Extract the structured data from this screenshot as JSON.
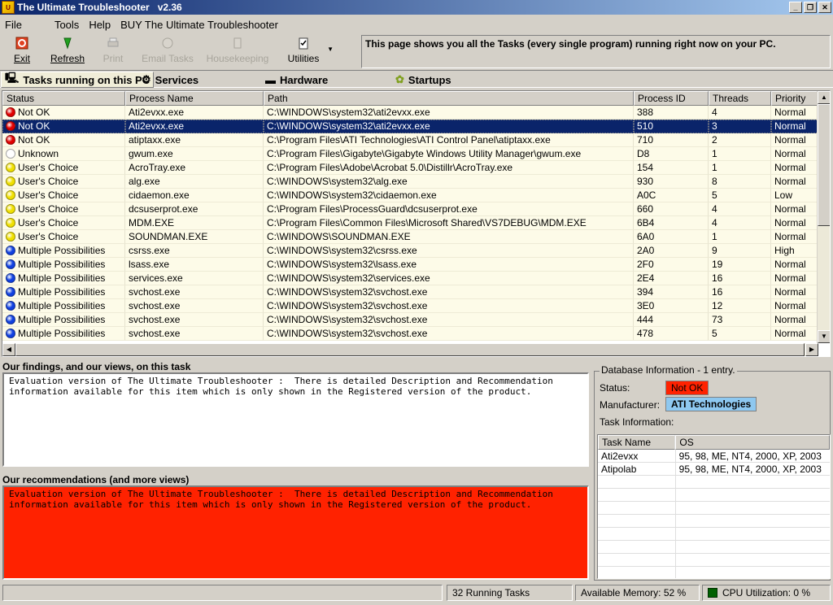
{
  "window": {
    "title": "The Ultimate Troubleshooter   v2.36"
  },
  "menu": [
    "File",
    "Tools",
    "Help",
    "BUY The Ultimate Troubleshooter"
  ],
  "toolbar": {
    "exit": "Exit",
    "refresh": "Refresh",
    "print": "Print",
    "email": "Email Tasks",
    "housekeeping": "Housekeeping",
    "utilities": "Utilities"
  },
  "info_text": "This page shows you all the Tasks (every single program) running right now on your PC.",
  "tabs": {
    "tasks": "Tasks running on this PC",
    "services": "Services",
    "hardware": "Hardware",
    "startups": "Startups"
  },
  "columns": [
    "Status",
    "Process Name",
    "Path",
    "Process ID",
    "Threads",
    "Priority"
  ],
  "status_colors": {
    "Not OK": "#e00000",
    "Unknown": "#ffffff",
    "User's Choice": "#f0e000",
    "Multiple Possibilities": "#1040e0"
  },
  "rows": [
    [
      "Not OK",
      "Ati2evxx.exe",
      "C:\\WINDOWS\\system32\\ati2evxx.exe",
      "388",
      "4",
      "Normal"
    ],
    [
      "Not OK",
      "Ati2evxx.exe",
      "C:\\WINDOWS\\system32\\ati2evxx.exe",
      "510",
      "3",
      "Normal"
    ],
    [
      "Not OK",
      "atiptaxx.exe",
      "C:\\Program Files\\ATI Technologies\\ATI Control Panel\\atiptaxx.exe",
      "710",
      "2",
      "Normal"
    ],
    [
      "Unknown",
      "gwum.exe",
      "C:\\Program Files\\Gigabyte\\Gigabyte Windows Utility Manager\\gwum.exe",
      "D8",
      "1",
      "Normal"
    ],
    [
      "User's Choice",
      "AcroTray.exe",
      "C:\\Program Files\\Adobe\\Acrobat 5.0\\Distillr\\AcroTray.exe",
      "154",
      "1",
      "Normal"
    ],
    [
      "User's Choice",
      "alg.exe",
      "C:\\WINDOWS\\system32\\alg.exe",
      "930",
      "8",
      "Normal"
    ],
    [
      "User's Choice",
      "cidaemon.exe",
      "C:\\WINDOWS\\system32\\cidaemon.exe",
      "A0C",
      "5",
      "Low"
    ],
    [
      "User's Choice",
      "dcsuserprot.exe",
      "C:\\Program Files\\ProcessGuard\\dcsuserprot.exe",
      "660",
      "4",
      "Normal"
    ],
    [
      "User's Choice",
      "MDM.EXE",
      "C:\\Program Files\\Common Files\\Microsoft Shared\\VS7DEBUG\\MDM.EXE",
      "6B4",
      "4",
      "Normal"
    ],
    [
      "User's Choice",
      "SOUNDMAN.EXE",
      "C:\\WINDOWS\\SOUNDMAN.EXE",
      "6A0",
      "1",
      "Normal"
    ],
    [
      "Multiple Possibilities",
      "csrss.exe",
      "C:\\WINDOWS\\system32\\csrss.exe",
      "2A0",
      "9",
      "High"
    ],
    [
      "Multiple Possibilities",
      "lsass.exe",
      "C:\\WINDOWS\\system32\\lsass.exe",
      "2F0",
      "19",
      "Normal"
    ],
    [
      "Multiple Possibilities",
      "services.exe",
      "C:\\WINDOWS\\system32\\services.exe",
      "2E4",
      "16",
      "Normal"
    ],
    [
      "Multiple Possibilities",
      "svchost.exe",
      "C:\\WINDOWS\\system32\\svchost.exe",
      "394",
      "16",
      "Normal"
    ],
    [
      "Multiple Possibilities",
      "svchost.exe",
      "C:\\WINDOWS\\system32\\svchost.exe",
      "3E0",
      "12",
      "Normal"
    ],
    [
      "Multiple Possibilities",
      "svchost.exe",
      "C:\\WINDOWS\\system32\\svchost.exe",
      "444",
      "73",
      "Normal"
    ],
    [
      "Multiple Possibilities",
      "svchost.exe",
      "C:\\WINDOWS\\system32\\svchost.exe",
      "478",
      "5",
      "Normal"
    ]
  ],
  "selected_row": 1,
  "findings": {
    "label": "Our findings, and our views, on this task",
    "text": "Evaluation version of The Ultimate Troubleshooter :  There is detailed Description and Recommendation\ninformation available for this item which is only shown in the Registered version of the product."
  },
  "recommendations": {
    "label": "Our recommendations (and more views)",
    "text": "Evaluation version of The Ultimate Troubleshooter :  There is detailed Description and Recommendation\ninformation available for this item which is only shown in the Registered version of the product.",
    "bg_color": "#ff2200"
  },
  "database": {
    "title": "Database Information - 1 entry.",
    "status_label": "Status:",
    "status_value": "Not OK",
    "status_color": "#ff2200",
    "manufacturer_label": "Manufacturer:",
    "manufacturer_value": "ATI Technologies",
    "manufacturer_color": "#8ec8f0",
    "task_info_label": "Task Information:",
    "columns": [
      "Task Name",
      "OS"
    ],
    "rows": [
      [
        "Ati2evxx",
        "95, 98, ME, NT4, 2000, XP, 2003"
      ],
      [
        "Atipolab",
        "95, 98, ME, NT4, 2000, XP, 2003"
      ]
    ]
  },
  "statusbar": {
    "running": "32 Running Tasks",
    "memory": "Available Memory:  52 %",
    "cpu": "CPU Utilization:  0 %"
  }
}
